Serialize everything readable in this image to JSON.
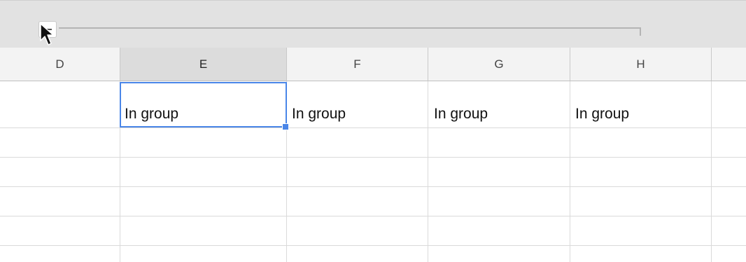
{
  "columns": [
    {
      "label": "D",
      "selected": false
    },
    {
      "label": "E",
      "selected": true
    },
    {
      "label": "F",
      "selected": false
    },
    {
      "label": "G",
      "selected": false
    },
    {
      "label": "H",
      "selected": false
    }
  ],
  "cells": {
    "E": "In group",
    "F": "In group",
    "G": "In group",
    "H": "In group"
  },
  "group": {
    "toggle_icon": "minus-icon",
    "state": "expanded"
  },
  "colors": {
    "selection": "#4a86e8",
    "header_bg": "#f3f3f3",
    "selected_header_bg": "#dcdcdc",
    "group_bar_bg": "#e2e2e2",
    "gridline": "#dadada"
  }
}
